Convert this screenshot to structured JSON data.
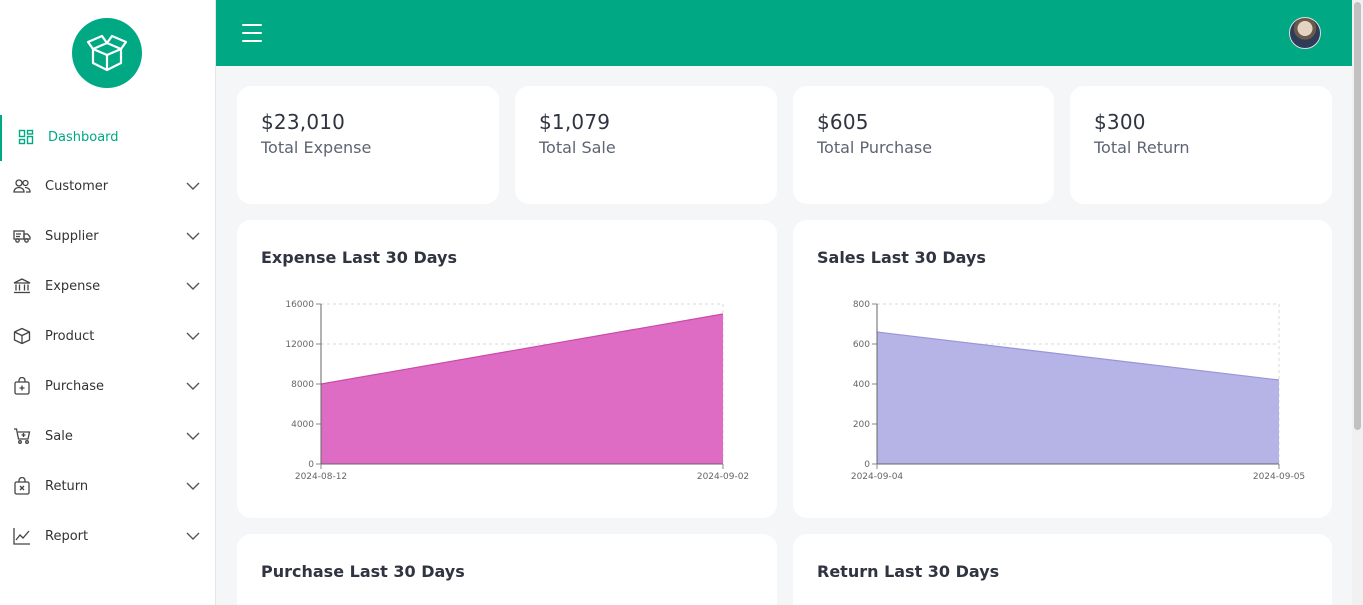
{
  "sidebar": {
    "items": [
      {
        "label": "Dashboard",
        "icon": "dashboard-icon",
        "active": true
      },
      {
        "label": "Customer",
        "icon": "users-icon"
      },
      {
        "label": "Supplier",
        "icon": "truck-icon"
      },
      {
        "label": "Expense",
        "icon": "bank-icon"
      },
      {
        "label": "Product",
        "icon": "box-icon"
      },
      {
        "label": "Purchase",
        "icon": "bag-icon"
      },
      {
        "label": "Sale",
        "icon": "cart-icon"
      },
      {
        "label": "Return",
        "icon": "return-bag-icon"
      },
      {
        "label": "Report",
        "icon": "chart-line-icon"
      }
    ]
  },
  "colors": {
    "accent": "#00a884",
    "expense_area": "#df6cc4",
    "sales_area": "#b6b3e7"
  },
  "stats": [
    {
      "amount": "$23,010",
      "label": "Total Expense"
    },
    {
      "amount": "$1,079",
      "label": "Total Sale"
    },
    {
      "amount": "$605",
      "label": "Total Purchase"
    },
    {
      "amount": "$300",
      "label": "Total Return"
    }
  ],
  "panels": {
    "expense": {
      "title": "Expense Last 30 Days"
    },
    "sales": {
      "title": "Sales Last 30 Days"
    },
    "purchase": {
      "title": "Purchase Last 30 Days"
    },
    "return": {
      "title": "Return Last 30 Days"
    }
  },
  "chart_data": [
    {
      "type": "area",
      "title": "Expense Last 30 Days",
      "x": [
        "2024-08-12",
        "2024-09-02"
      ],
      "values": [
        8000,
        15000
      ],
      "ylim": [
        0,
        16000
      ],
      "yticks": [
        0,
        4000,
        8000,
        12000,
        16000
      ],
      "grid": true
    },
    {
      "type": "area",
      "title": "Sales Last 30 Days",
      "x": [
        "2024-09-04",
        "2024-09-05"
      ],
      "values": [
        660,
        420
      ],
      "ylim": [
        0,
        800
      ],
      "yticks": [
        0,
        200,
        400,
        600,
        800
      ],
      "grid": true
    }
  ]
}
